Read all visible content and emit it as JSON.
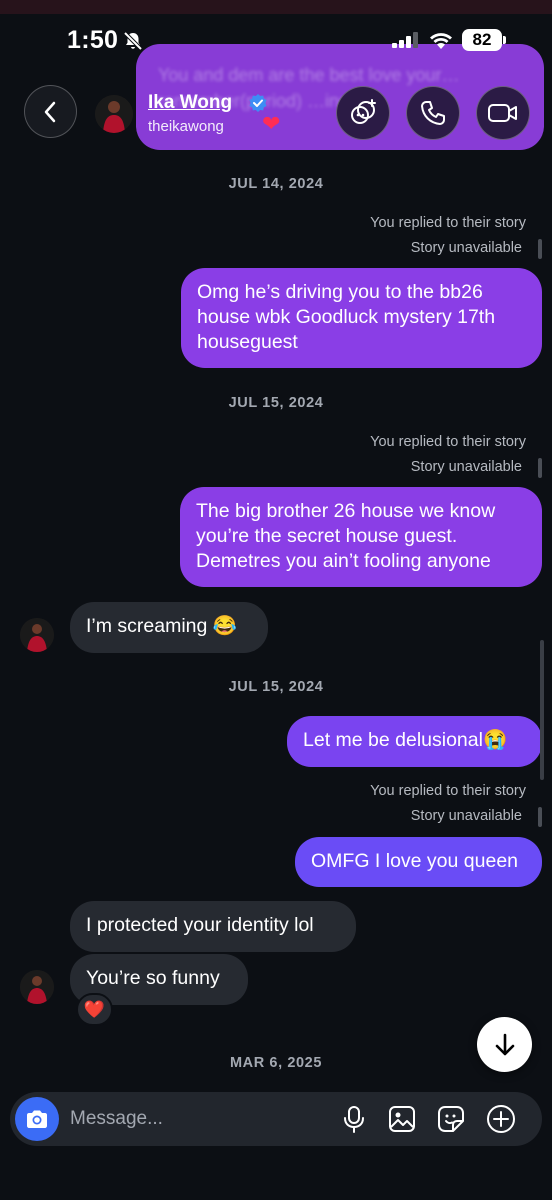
{
  "status_bar": {
    "time": "1:50",
    "battery": "82"
  },
  "ghost_preview": {
    "text": "You and dem are the best love your… remember(period) …ing!!"
  },
  "header": {
    "name": "Ika Wong",
    "handle": "theikawong",
    "icons": [
      "back-icon",
      "verified-badge-icon",
      "effects-icon",
      "phone-icon",
      "video-icon"
    ]
  },
  "messages": {
    "date1": "JUL 14, 2024",
    "reply1": "You replied to their story",
    "story1": "Story unavailable",
    "out1": "Omg he’s driving you to the bb26 house wbk Goodluck mystery 17th houseguest",
    "date2": "JUL 15, 2024",
    "reply2": "You replied to their story",
    "story2": "Story unavailable",
    "out2": "The big brother 26 house we know you’re the secret house guest. Demetres you ain’t fooling anyone",
    "in1": "I’m screaming 😂",
    "date3": "JUL 15, 2024",
    "out3": "Let me be delusional😭",
    "reply3": "You replied to their story",
    "story3": "Story unavailable",
    "out4": "OMFG I love you queen",
    "in2": "I protected your identity lol",
    "in3": "You’re so funny",
    "reaction": "❤️",
    "date4": "MAR 6, 2025"
  },
  "composer": {
    "placeholder": "Message...",
    "icons": [
      "camera-icon",
      "microphone-icon",
      "gallery-icon",
      "sticker-icon",
      "plus-icon"
    ]
  },
  "colors": {
    "bubble_purple": "#8a3ee6",
    "bubble_violet": "#6a4cf6",
    "incoming": "#262a31",
    "background": "#0c0f14",
    "camera_blue": "#3b6cf6"
  }
}
